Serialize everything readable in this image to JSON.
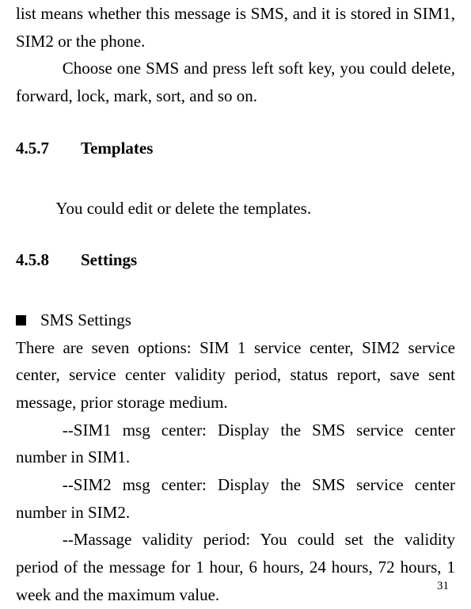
{
  "intro": {
    "p1": "list means whether this message is SMS, and it is stored in SIM1, SIM2 or the phone.",
    "p2": "Choose one SMS and press left soft key, you could delete, forward, lock, mark, sort, and so on."
  },
  "section_templates": {
    "number": "4.5.7",
    "title": "Templates",
    "body": "You could edit or delete the templates."
  },
  "section_settings": {
    "number": "4.5.8",
    "title": "Settings",
    "bullet_label": "SMS Settings",
    "intro": "There are seven options: SIM 1 service center, SIM2 service center, service center validity period, status report, save sent message, prior storage medium.",
    "item1": "--SIM1 msg center: Display the SMS service center number in SIM1.",
    "item2": "--SIM2 msg center: Display the SMS service center number in SIM2.",
    "item3": "--Massage validity period: You could set the validity period of the message for 1 hour, 6 hours, 24 hours, 72 hours, 1 week and the maximum value."
  },
  "page_number": "31"
}
